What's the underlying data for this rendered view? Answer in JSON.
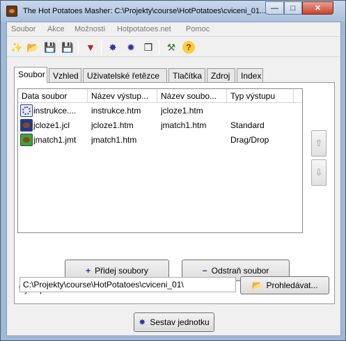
{
  "window": {
    "title": "The Hot Potatoes Masher: C:\\Projekty\\course\\HotPotatoes\\cviceni_01...",
    "minimize_glyph": "—",
    "maximize_glyph": "□",
    "close_glyph": "✕"
  },
  "menu": [
    "Soubor",
    "Akce",
    "Možnosti",
    "Hotpotatoes.net",
    "Pomoc"
  ],
  "toolbar": {
    "new_glyph": "✨",
    "open_glyph": "📂",
    "save_glyph": "💾",
    "saveas_glyph": "💾",
    "down_glyph": "▼",
    "build_glyph": "✸",
    "build2_glyph": "✹",
    "copy_glyph": "❐",
    "tools_glyph": "⚒",
    "help_glyph": "?"
  },
  "tabs": [
    "Soubor",
    "Vzhled",
    "Uživatelské řetězce",
    "Tlačítka",
    "Zdroj",
    "Index"
  ],
  "files": {
    "columns": [
      "Data soubor",
      "Název výstup...",
      "Název soubo...",
      "Typ výstupu"
    ],
    "rows": [
      {
        "data": "instrukce....",
        "output": "instrukce.htm",
        "next": "jcloze1.htm",
        "type": "",
        "icon": "masher-icon"
      },
      {
        "data": "jcloze1.jcl",
        "output": "jcloze1.htm",
        "next": "jmatch1.htm",
        "type": "Standard",
        "icon": "jcloze-icon"
      },
      {
        "data": "jmatch1.jmt",
        "output": "jmatch1.htm",
        "next": "",
        "type": "Drag/Drop",
        "icon": "jmatch-icon"
      }
    ],
    "up_glyph": "⇧",
    "down_glyph": "⇩"
  },
  "buttons": {
    "add": "Přidej soubory",
    "add_glyph": "+",
    "remove": "Odstraň soubor",
    "remove_glyph": "−",
    "browse": "Prohledávat...",
    "browse_glyph": "📂",
    "build": "Sestav jednotku",
    "build_glyph": "✸"
  },
  "output_folder": {
    "label": "Výstupní složka:",
    "value": "C:\\Projekty\\course\\HotPotatoes\\cviceni_01\\"
  }
}
